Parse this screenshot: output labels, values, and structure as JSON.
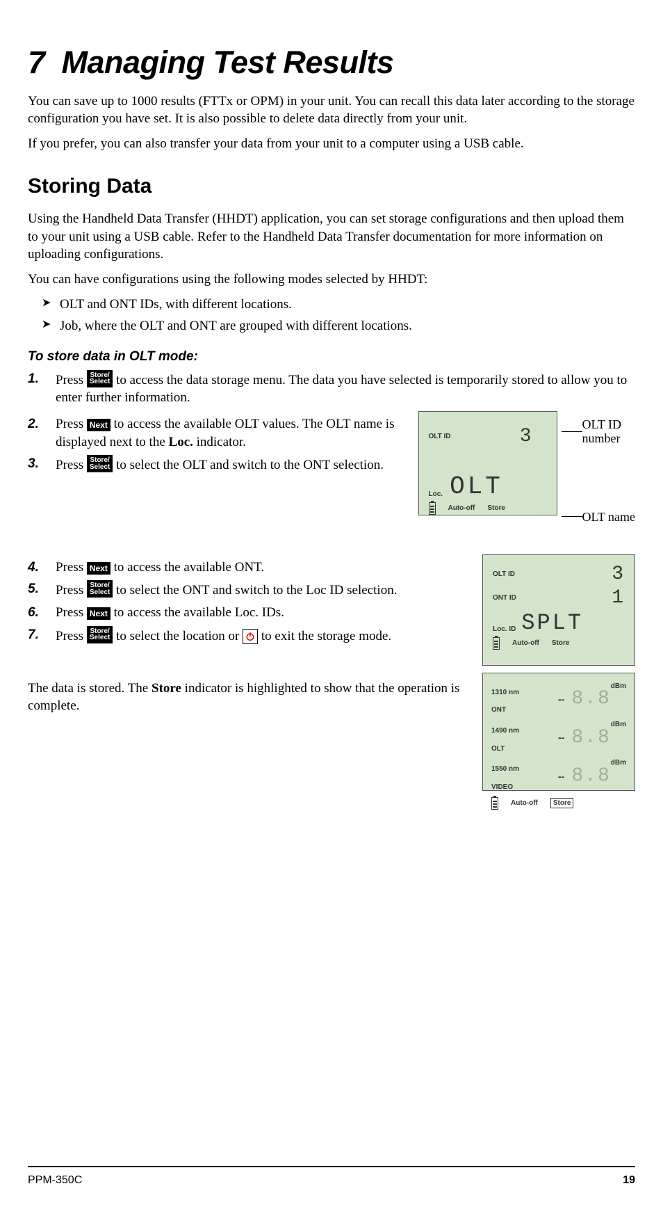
{
  "chapter": {
    "number": "7",
    "title": "Managing Test Results"
  },
  "intro": {
    "p1": "You can save up to 1000 results (FTTx or OPM) in your unit. You can recall this data later according to the storage configuration you have set. It is also possible to delete data directly from your unit.",
    "p2": "If you prefer, you can also transfer your data from your unit to a computer using a USB cable."
  },
  "section1": {
    "title": "Storing Data",
    "p1": "Using the Handheld Data Transfer (HHDT) application, you can set storage configurations and then upload them to your unit using a USB cable. Refer to the Handheld Data Transfer documentation for more information on uploading configurations.",
    "p2": "You can have configurations using the following modes selected by HHDT:",
    "bullets": [
      "OLT and ONT IDs, with different locations.",
      "Job, where the OLT and ONT are grouped with different locations."
    ],
    "procedure_title": "To store data in OLT mode:",
    "steps": {
      "s1a": " to access the data storage menu. The data you have selected is temporarily stored to allow you to enter further information.",
      "s2a": " to access the available OLT values. The OLT name is displayed next to the ",
      "s2b": " indicator.",
      "s2loc": "Loc.",
      "s3a": " to select the OLT and switch to the ONT selection.",
      "s4a": " to access the available ONT.",
      "s5a": " to select the ONT and switch to the Loc ID selection.",
      "s6a": " to access the available Loc. IDs.",
      "s7a": " to select the location or ",
      "s7b": " to exit the storage mode."
    },
    "press": "Press ",
    "closing_a": "The data is stored. The ",
    "closing_store": "Store",
    "closing_b": " indicator is highlighted to show that the operation is complete."
  },
  "keys": {
    "store_select_l1": "Store/",
    "store_select_l2": "Select",
    "next": "Next"
  },
  "lcd1": {
    "olt_id_label": "OLT ID",
    "olt_id_value": "3",
    "loc_label": "Loc.",
    "name_value": "OLT",
    "autooff": "Auto-off",
    "store": "Store",
    "callout1": "OLT ID number",
    "callout2": "OLT name"
  },
  "lcd2": {
    "olt_id_label": "OLT ID",
    "olt_id_value": "3",
    "ont_id_label": "ONT ID",
    "ont_id_value": "1",
    "loc_id_label": "Loc. ID",
    "loc_value": "SPLT",
    "autooff": "Auto-off",
    "store": "Store"
  },
  "lcd3": {
    "rows": [
      {
        "wl": "1310 nm",
        "src": "ONT",
        "val": "--",
        "disp": "8.8",
        "unit": "dBm"
      },
      {
        "wl": "1490 nm",
        "src": "OLT",
        "val": "--",
        "disp": "8.8",
        "unit": "dBm"
      },
      {
        "wl": "1550 nm",
        "src": "VIDEO",
        "val": "--",
        "disp": "8.8",
        "unit": "dBm"
      }
    ],
    "autooff": "Auto-off",
    "store": "Store"
  },
  "footer": {
    "model": "PPM-350C",
    "page": "19"
  }
}
